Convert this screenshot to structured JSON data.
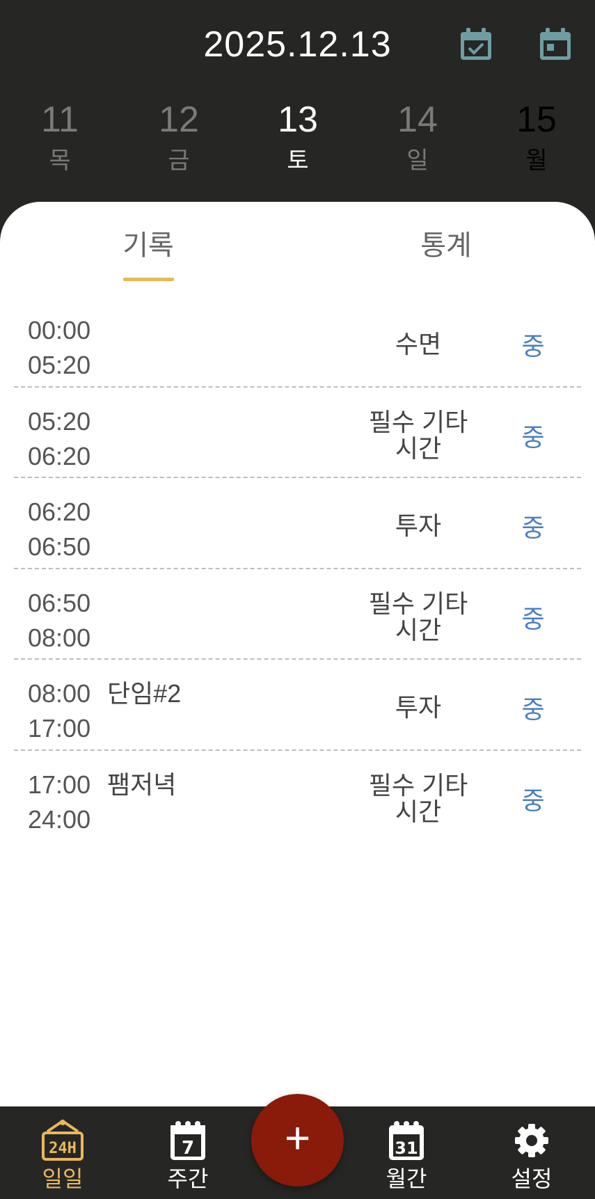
{
  "header": {
    "date": "2025.12.13",
    "icons": [
      "calendar-check-icon",
      "calendar-today-icon"
    ]
  },
  "days": [
    {
      "num": "11",
      "weekday": "목"
    },
    {
      "num": "12",
      "weekday": "금"
    },
    {
      "num": "13",
      "weekday": "토"
    },
    {
      "num": "14",
      "weekday": "일"
    },
    {
      "num": "15",
      "weekday": "월"
    }
  ],
  "tabs": {
    "record": "기록",
    "stats": "통계"
  },
  "entries": [
    {
      "start": "00:00",
      "end": "05:20",
      "memo": "",
      "category": "수면",
      "level": "중"
    },
    {
      "start": "05:20",
      "end": "06:20",
      "memo": "",
      "category": "필수 기타\n시간",
      "level": "중"
    },
    {
      "start": "06:20",
      "end": "06:50",
      "memo": "",
      "category": "투자",
      "level": "중"
    },
    {
      "start": "06:50",
      "end": "08:00",
      "memo": "",
      "category": "필수 기타\n시간",
      "level": "중"
    },
    {
      "start": "08:00",
      "end": "17:00",
      "memo": "단임#2",
      "category": "투자",
      "level": "중"
    },
    {
      "start": "17:00",
      "end": "24:00",
      "memo": "팸저녁",
      "category": "필수 기타\n시간",
      "level": "중"
    }
  ],
  "nav": {
    "daily": "일일",
    "weekly": "주간",
    "weekly_icon_text": "7",
    "monthly": "월간",
    "monthly_icon_text": "31",
    "settings": "설정",
    "daily_icon_text": "24H"
  },
  "fab": {
    "label": "+"
  },
  "colors": {
    "accent": "#eab85a",
    "fab": "#8a1a0a",
    "level": "#4a7ec3",
    "icon_teal": "#6e9ea3"
  }
}
